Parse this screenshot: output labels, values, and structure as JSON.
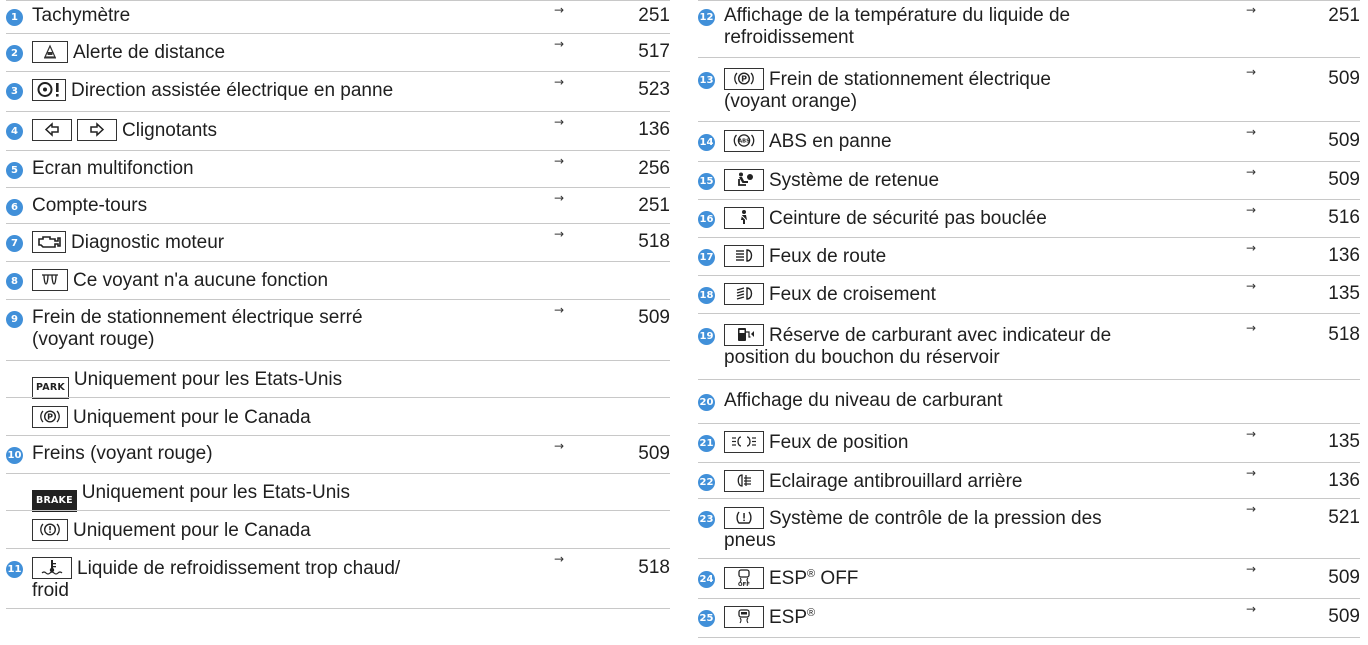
{
  "left": [
    {
      "num": "1",
      "text": "Tachymètre",
      "page": "251"
    },
    {
      "num": "2",
      "text": "Alerte de distance",
      "page": "517",
      "icon": "distance-warning-icon"
    },
    {
      "num": "3",
      "text": "Direction assistée électrique en panne",
      "page": "523",
      "icon": "power-steering-icon"
    },
    {
      "num": "4",
      "text": "Clignotants",
      "page": "136",
      "icon": "turn-signal-icon"
    },
    {
      "num": "5",
      "text": "Ecran multifonction",
      "page": "256"
    },
    {
      "num": "6",
      "text": "Compte-tours",
      "page": "251"
    },
    {
      "num": "7",
      "text": "Diagnostic moteur",
      "page": "518",
      "icon": "engine-icon"
    },
    {
      "num": "8",
      "text": "Ce voyant n'a aucune fonction",
      "page": "",
      "icon": "preglow-icon"
    },
    {
      "num": "9",
      "text_line1": "Frein de stationnement électrique serré",
      "text_line2": "(voyant rouge)",
      "page": "509"
    },
    {
      "sub": true,
      "icon_text": "PARK",
      "text": "Uniquement pour les Etats-Unis"
    },
    {
      "sub": true,
      "text": "Uniquement pour le Canada",
      "icon": "parking-brake-icon"
    },
    {
      "num": "10",
      "text": "Freins (voyant rouge)",
      "page": "509"
    },
    {
      "sub": true,
      "icon_text": "BRAKE",
      "text": "Uniquement pour les Etats-Unis"
    },
    {
      "sub": true,
      "text": "Uniquement pour le Canada",
      "icon": "brake-warning-icon"
    },
    {
      "num": "11",
      "text_line1": "Liquide de refroidissement trop chaud/",
      "text_line2": "froid",
      "page": "518",
      "icon": "coolant-temp-icon"
    }
  ],
  "right": [
    {
      "num": "12",
      "text_line1": "Affichage de la température du liquide de",
      "text_line2": "refroidissement",
      "page": "251"
    },
    {
      "num": "13",
      "text_line1": "Frein de stationnement électrique",
      "text_line2": "(voyant orange)",
      "page": "509",
      "icon": "parking-brake-icon"
    },
    {
      "num": "14",
      "text": "ABS en panne",
      "page": "509",
      "icon": "abs-icon"
    },
    {
      "num": "15",
      "text": "Système de retenue",
      "page": "509",
      "icon": "airbag-icon"
    },
    {
      "num": "16",
      "text": "Ceinture de sécurité pas bouclée",
      "page": "516",
      "icon": "seatbelt-icon"
    },
    {
      "num": "17",
      "text": "Feux de route",
      "page": "136",
      "icon": "high-beam-icon"
    },
    {
      "num": "18",
      "text": "Feux de croisement",
      "page": "135",
      "icon": "low-beam-icon"
    },
    {
      "num": "19",
      "text_line1": "Réserve de carburant avec indicateur de",
      "text_line2": "position du bouchon du réservoir",
      "page": "518",
      "icon": "fuel-icon"
    },
    {
      "num": "20",
      "text": "Affichage du niveau de carburant",
      "page": ""
    },
    {
      "num": "21",
      "text": "Feux de position",
      "page": "135",
      "icon": "position-lights-icon"
    },
    {
      "num": "22",
      "text": "Eclairage antibrouillard arrière",
      "page": "136",
      "icon": "rear-fog-icon"
    },
    {
      "num": "23",
      "text_line1": "Système de contrôle de la pression des",
      "text_line2": "pneus",
      "page": "521",
      "icon": "tire-pressure-icon"
    },
    {
      "num": "24",
      "text": "ESP",
      "text_sup": "®",
      "text_suffix": " OFF",
      "page": "509",
      "icon": "esp-off-icon"
    },
    {
      "num": "25",
      "text": "ESP",
      "text_sup": "®",
      "page": "509",
      "icon": "esp-icon"
    }
  ],
  "arrow_glyph": "→",
  "colors": {
    "number_badge": "#4190d9",
    "rule": "#c8c8c8",
    "text": "#1f1f1f"
  }
}
